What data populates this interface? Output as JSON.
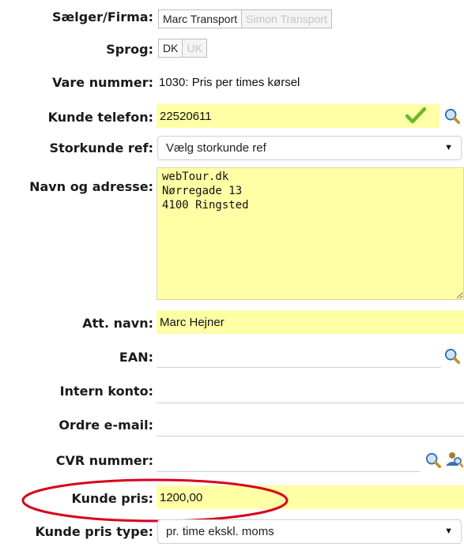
{
  "fields": {
    "seller": {
      "label": "Sælger/Firma:",
      "options": [
        "Marc Transport",
        "Simon Transport"
      ],
      "active": "Marc Transport"
    },
    "language": {
      "label": "Sprog:",
      "options": [
        "DK",
        "UK"
      ],
      "active": "DK"
    },
    "item_number": {
      "label": "Vare nummer:",
      "value": "1030: Pris per times kørsel"
    },
    "customer_phone": {
      "label": "Kunde telefon:",
      "value": "22520611"
    },
    "key_account_ref": {
      "label": "Storkunde ref:",
      "selected": "Vælg storkunde ref"
    },
    "name_address": {
      "label": "Navn og adresse:",
      "value": "webTour.dk\nNørregade 13\n4100 Ringsted"
    },
    "att_name": {
      "label": "Att. navn:",
      "value": "Marc Hejner"
    },
    "ean": {
      "label": "EAN:",
      "value": ""
    },
    "internal_account": {
      "label": "Intern konto:",
      "value": ""
    },
    "order_email": {
      "label": "Ordre e-mail:",
      "value": ""
    },
    "cvr_number": {
      "label": "CVR nummer:",
      "value": ""
    },
    "customer_price": {
      "label": "Kunde pris:",
      "value": "1200,00"
    },
    "customer_price_type": {
      "label": "Kunde pris type:",
      "selected": "pr. time ekskl. moms"
    }
  },
  "colors": {
    "field_yellow": "#ffffa5",
    "check_green": "#6cb62d",
    "annotation_red": "#d9001b"
  },
  "icons": {
    "verified": "check-icon",
    "lookup": "magnifier-icon",
    "people_lookup": "people-search-icon"
  }
}
